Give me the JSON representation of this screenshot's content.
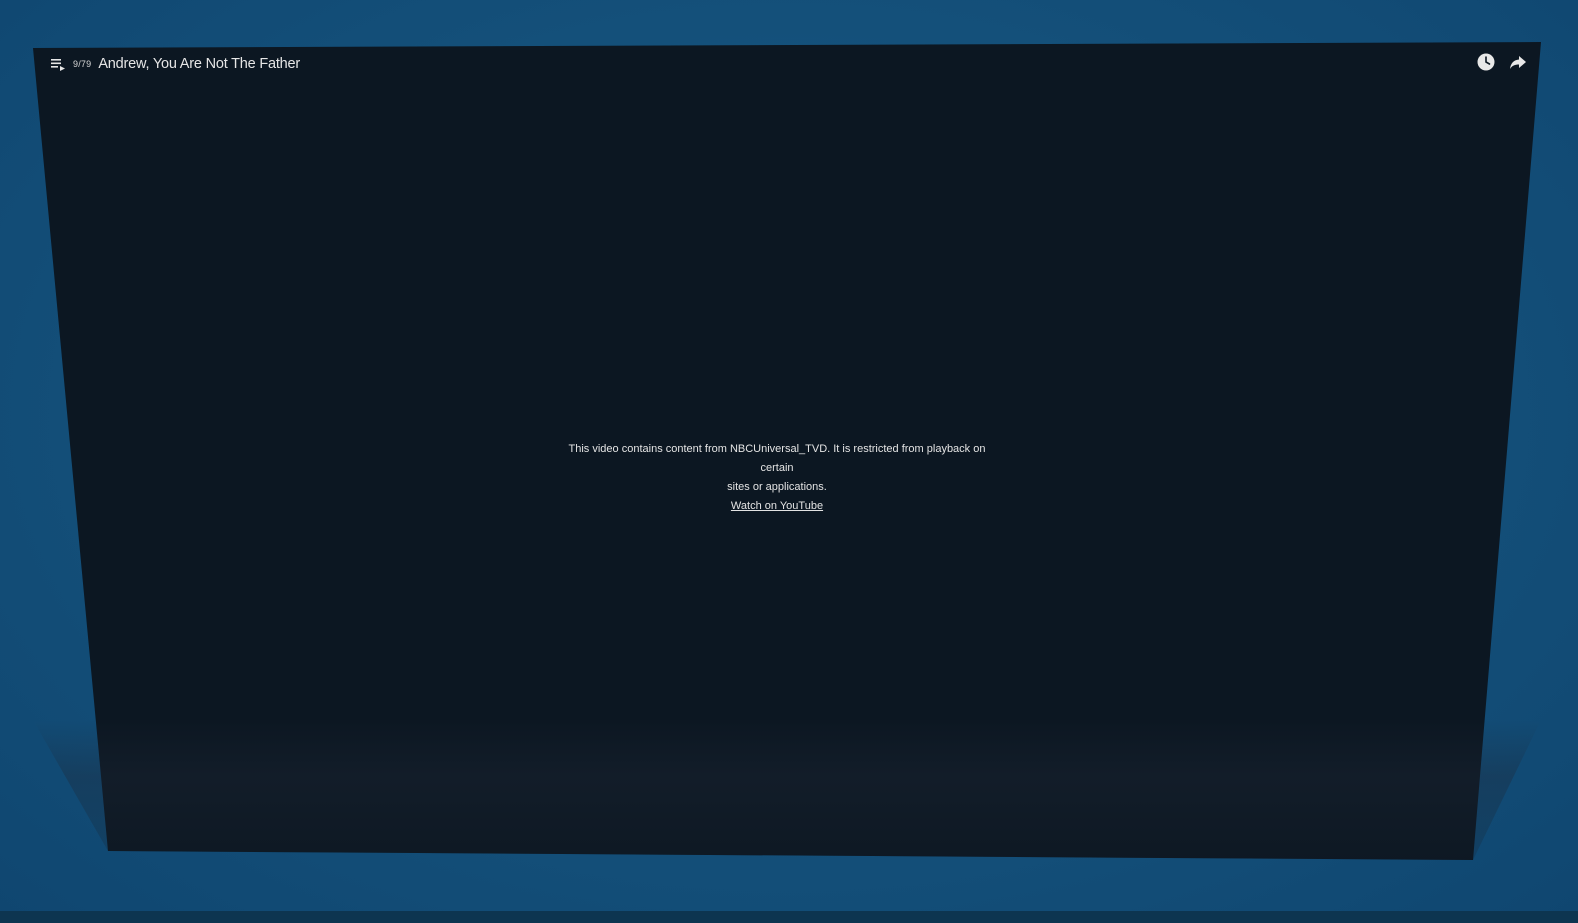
{
  "player": {
    "playlist_counter": "9/79",
    "title": "Andrew, You Are Not The Father",
    "message_line1": "This video contains content from NBCUniversal_TVD. It is restricted from playback on certain",
    "message_line2": "sites or applications.",
    "watch_link": "Watch on YouTube"
  },
  "icons": {
    "playlist": "playlist-icon",
    "watch_later": "clock-icon",
    "share": "share-icon"
  },
  "colors": {
    "background": "#14507a",
    "screen": "#0c1722",
    "text": "#e4e4e4"
  }
}
